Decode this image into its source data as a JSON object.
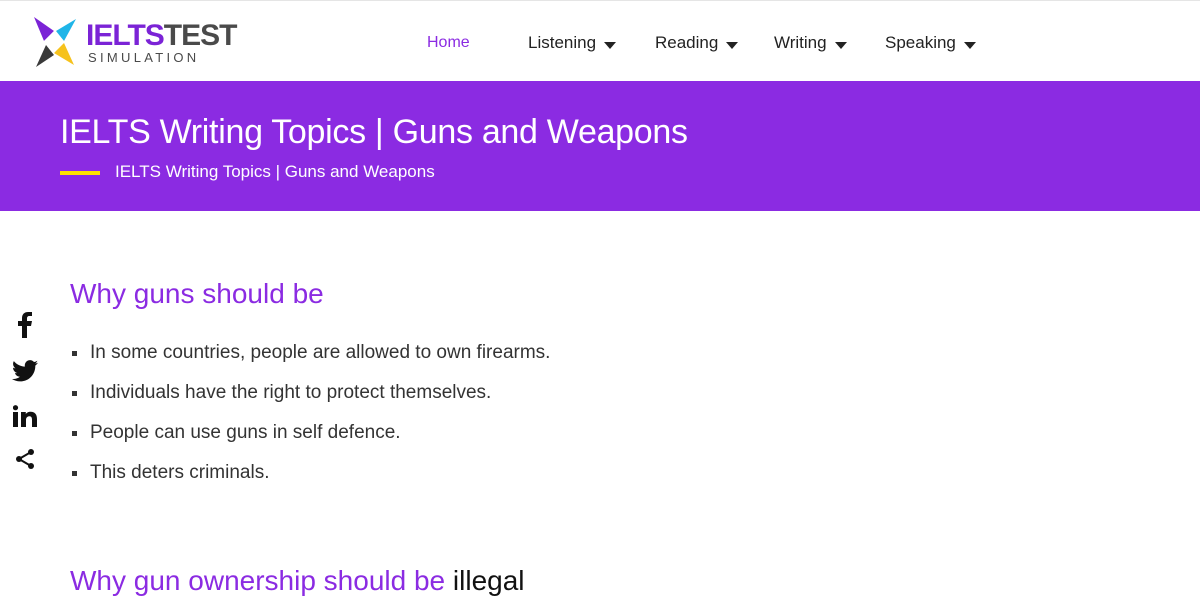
{
  "logo": {
    "brand_part1": "IELTS",
    "brand_part2": "TEST",
    "subtitle": "SIMULATION"
  },
  "nav": {
    "items": [
      {
        "label": "Home",
        "active": true,
        "has_dropdown": false
      },
      {
        "label": "Listening",
        "active": false,
        "has_dropdown": true
      },
      {
        "label": "Reading",
        "active": false,
        "has_dropdown": true
      },
      {
        "label": "Writing",
        "active": false,
        "has_dropdown": true
      },
      {
        "label": "Speaking",
        "active": false,
        "has_dropdown": true
      }
    ]
  },
  "banner": {
    "title": "IELTS Writing Topics | Guns and Weapons",
    "breadcrumb": "IELTS Writing Topics | Guns and Weapons"
  },
  "social": {
    "icons": [
      "facebook-icon",
      "twitter-icon",
      "linkedin-icon",
      "share-icon"
    ]
  },
  "main": {
    "section1": {
      "heading": "Why guns should be",
      "bullets": [
        "In some countries, people are allowed to own firearms.",
        "Individuals have the right to protect themselves.",
        "People can use guns in self defence.",
        "This deters criminals."
      ]
    },
    "section2": {
      "heading_part1": "Why gun ownership should be ",
      "heading_part2": "illegal"
    }
  },
  "colors": {
    "brand_purple": "#8b2be2",
    "accent_yellow": "#ffe100",
    "text_dark": "#333333"
  }
}
